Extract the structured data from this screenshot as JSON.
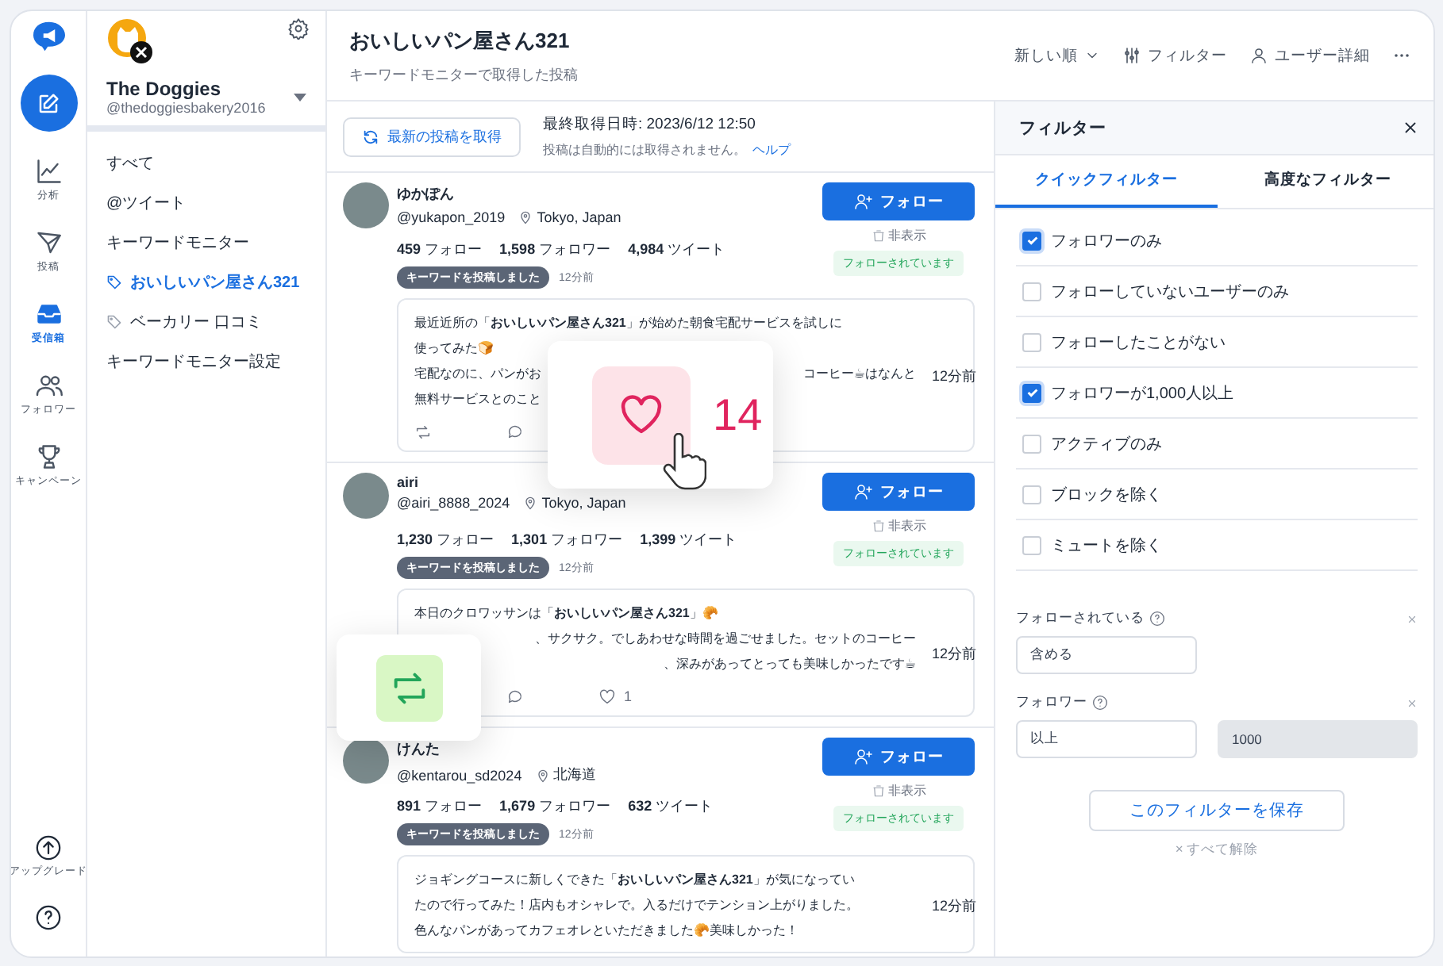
{
  "rail": {
    "items": [
      {
        "label": "分析",
        "kind": "chart",
        "selected": false
      },
      {
        "label": "投稿",
        "kind": "send",
        "selected": false
      },
      {
        "label": "受信箱",
        "kind": "inbox",
        "selected": true
      },
      {
        "label": "フォロワー",
        "kind": "users",
        "selected": false
      },
      {
        "label": "キャンペーン",
        "kind": "trophy",
        "selected": false
      }
    ],
    "upgrade": "アップグレード"
  },
  "sidebar": {
    "account": {
      "name": "The Doggies",
      "handle": "@thedoggiesbakery2016"
    },
    "items": [
      {
        "label": "すべて",
        "kind": "plain",
        "selected": false
      },
      {
        "label": "@ツイート",
        "kind": "plain",
        "selected": false
      },
      {
        "label": "キーワードモニター",
        "kind": "plain",
        "selected": false
      },
      {
        "label": "おいしいパン屋さん321",
        "kind": "tag",
        "selected": true
      },
      {
        "label": "ベーカリー 口コミ",
        "kind": "tag",
        "selected": false
      },
      {
        "label": "キーワードモニター設定",
        "kind": "plain",
        "selected": false
      }
    ]
  },
  "header": {
    "title": "おいしいパン屋さん321",
    "subtitle": "キーワードモニターで取得した投稿",
    "actions": [
      {
        "label": "新しい順",
        "kind": "sort"
      },
      {
        "label": "フィルター",
        "kind": "filter"
      },
      {
        "label": "ユーザー詳細",
        "kind": "user"
      }
    ]
  },
  "fetch_bar": {
    "button": "最新の投稿を取得",
    "last_fetched": "最終取得日時: 2023/6/12 12:50",
    "note": "投稿は自動的には取得されません。",
    "help": "ヘルプ"
  },
  "posts": [
    {
      "name": "ゆかぽん",
      "handle": "@yukapon_2019",
      "location": "Tokyo, Japan",
      "stats": [
        "**459** フォロー",
        "**1,598** フォロワー",
        "**4,984** ツイート"
      ],
      "follow": "フォロー",
      "hide": "非表示",
      "status": "フォローされています",
      "tag": "キーワードを投稿しました",
      "tag_time": "12分前",
      "lines": [
        {
          "kind": "plain",
          "text": "最近近所の「**おいしいパン屋さん321**」が始めた朝食宅配サービスを試しに"
        },
        {
          "kind": "plain",
          "text": "使ってみた🍞"
        },
        {
          "kind": "split",
          "text": "宅配なのに、パンがお",
          "text_after": "コーヒー☕はなんと"
        },
        {
          "kind": "plain",
          "text": "無料サービスとのこと"
        }
      ],
      "time": "12分前",
      "popup": {
        "kind": "like",
        "count": "14"
      },
      "actions": [
        {
          "kind": "retweet"
        },
        {
          "kind": "reply"
        }
      ]
    },
    {
      "name": "airi",
      "handle": "@airi_8888_2024",
      "location": "Tokyo, Japan",
      "stats": [
        "**1,230** フォロー",
        "**1,301** フォロワー",
        "**1,399** ツイート"
      ],
      "follow": "フォロー",
      "hide": "非表示",
      "status": "フォローされています",
      "tag": "キーワードを投稿しました",
      "tag_time": "12分前",
      "lines": [
        {
          "kind": "plain",
          "text": "本日のクロワッサンは「**おいしいパン屋さん321**」🥐"
        },
        {
          "kind": "cut_start",
          "text": "、サクサク。でしあわせな時間を過ごせました。セットのコーヒー"
        },
        {
          "kind": "cut_start",
          "text": "、深みがあってとっても美味しかったです☕"
        }
      ],
      "time": "12分前",
      "popup": {
        "kind": "retweet"
      },
      "actions": [
        {
          "kind": "reply"
        },
        {
          "kind": "like",
          "count": "1"
        }
      ]
    },
    {
      "name": "けんた",
      "handle": "@kentarou_sd2024",
      "location": "北海道",
      "stats": [
        "**891** フォロー",
        "**1,679** フォロワー",
        "**632** ツイート"
      ],
      "follow": "フォロー",
      "hide": "非表示",
      "status": "フォローされています",
      "tag": "キーワードを投稿しました",
      "tag_time": "12分前",
      "lines": [
        {
          "kind": "plain",
          "text": "ジョギングコースに新しくできた「**おいしいパン屋さん321**」が気になってい"
        },
        {
          "kind": "plain",
          "text": "たので行ってみた！店内もオシャレで。入るだけでテンション上がりました。"
        },
        {
          "kind": "plain",
          "text": "色んなパンがあってカフェオレといただきました🥐美味しかった！"
        }
      ],
      "time": "12分前"
    }
  ],
  "filter_panel": {
    "title": "フィルター",
    "tabs": [
      {
        "label": "クイックフィルター",
        "selected": true
      },
      {
        "label": "高度なフィルター",
        "selected": false
      }
    ],
    "options": [
      {
        "label": "フォロワーのみ",
        "checked": true
      },
      {
        "label": "フォローしていないユーザーのみ",
        "checked": false
      },
      {
        "label": "フォローしたことがない",
        "checked": false
      },
      {
        "label": "フォロワーが1,000人以上",
        "checked": true
      },
      {
        "label": "アクティブのみ",
        "checked": false
      },
      {
        "label": "ブロックを除く",
        "checked": false
      },
      {
        "label": "ミュートを除く",
        "checked": false
      }
    ],
    "fields": [
      {
        "label": "フォローされている",
        "inputs": [
          {
            "value": "含める",
            "disabled": false
          }
        ]
      },
      {
        "label": "フォロワー",
        "inputs": [
          {
            "value": "以上",
            "disabled": false
          },
          {
            "value": "1000",
            "disabled": true
          }
        ]
      }
    ],
    "save": "このフィルターを保存",
    "clear": "× すべて解除"
  }
}
